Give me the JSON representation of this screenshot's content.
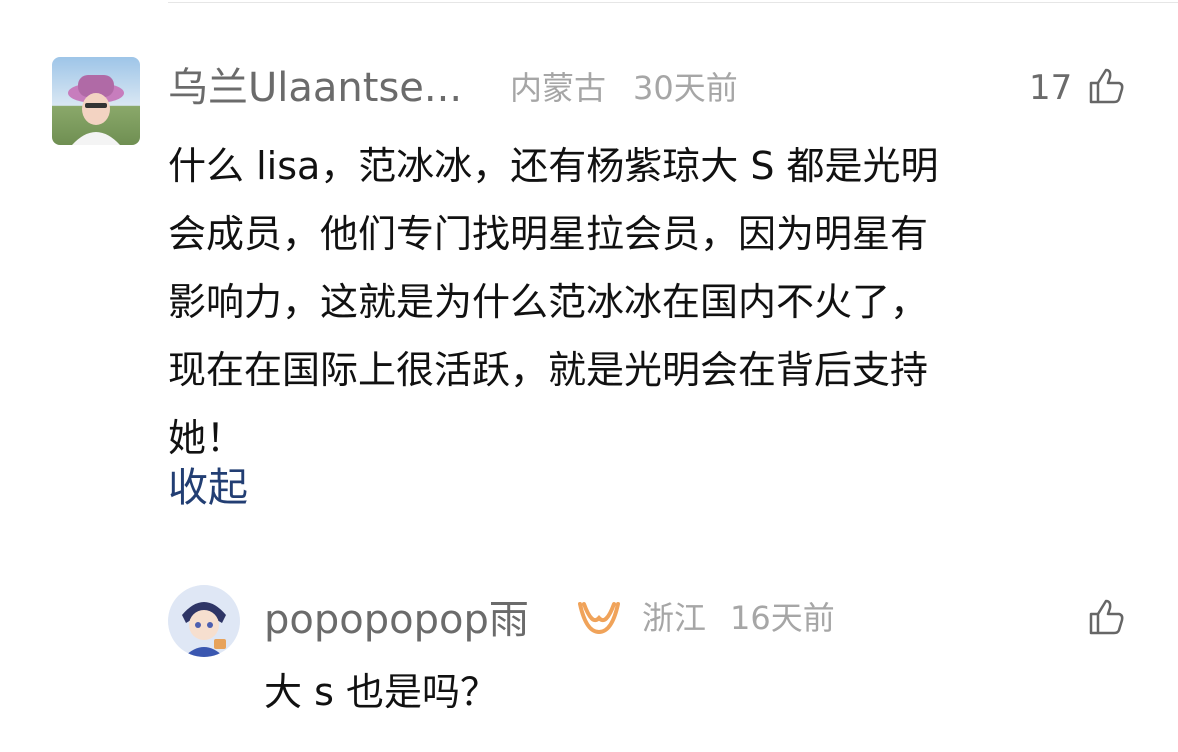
{
  "comment": {
    "author": "乌兰Ulaantse...",
    "location": "内蒙古",
    "time": "30天前",
    "likes": "17",
    "lines": [
      "什么 lisa，范冰冰，还有杨紫琼大 S 都是光明",
      "会成员，他们专门找明星拉会员，因为明星有",
      "影响力，这就是为什么范冰冰在国内不火了，",
      "现在在国际上很活跃，就是光明会在背后支持",
      "她！"
    ],
    "collapse_label": "收起"
  },
  "reply": {
    "author": "popopopop雨",
    "location": "浙江",
    "time": "16天前",
    "text": "大 s 也是吗？"
  },
  "icons": {
    "like": "thumbs-up-icon",
    "badge": "vip-badge-icon"
  },
  "colors": {
    "text": "#111111",
    "name": "#6b6b6b",
    "meta": "#a6a6a6",
    "link": "#223e73",
    "badge": "#f0a35a"
  }
}
